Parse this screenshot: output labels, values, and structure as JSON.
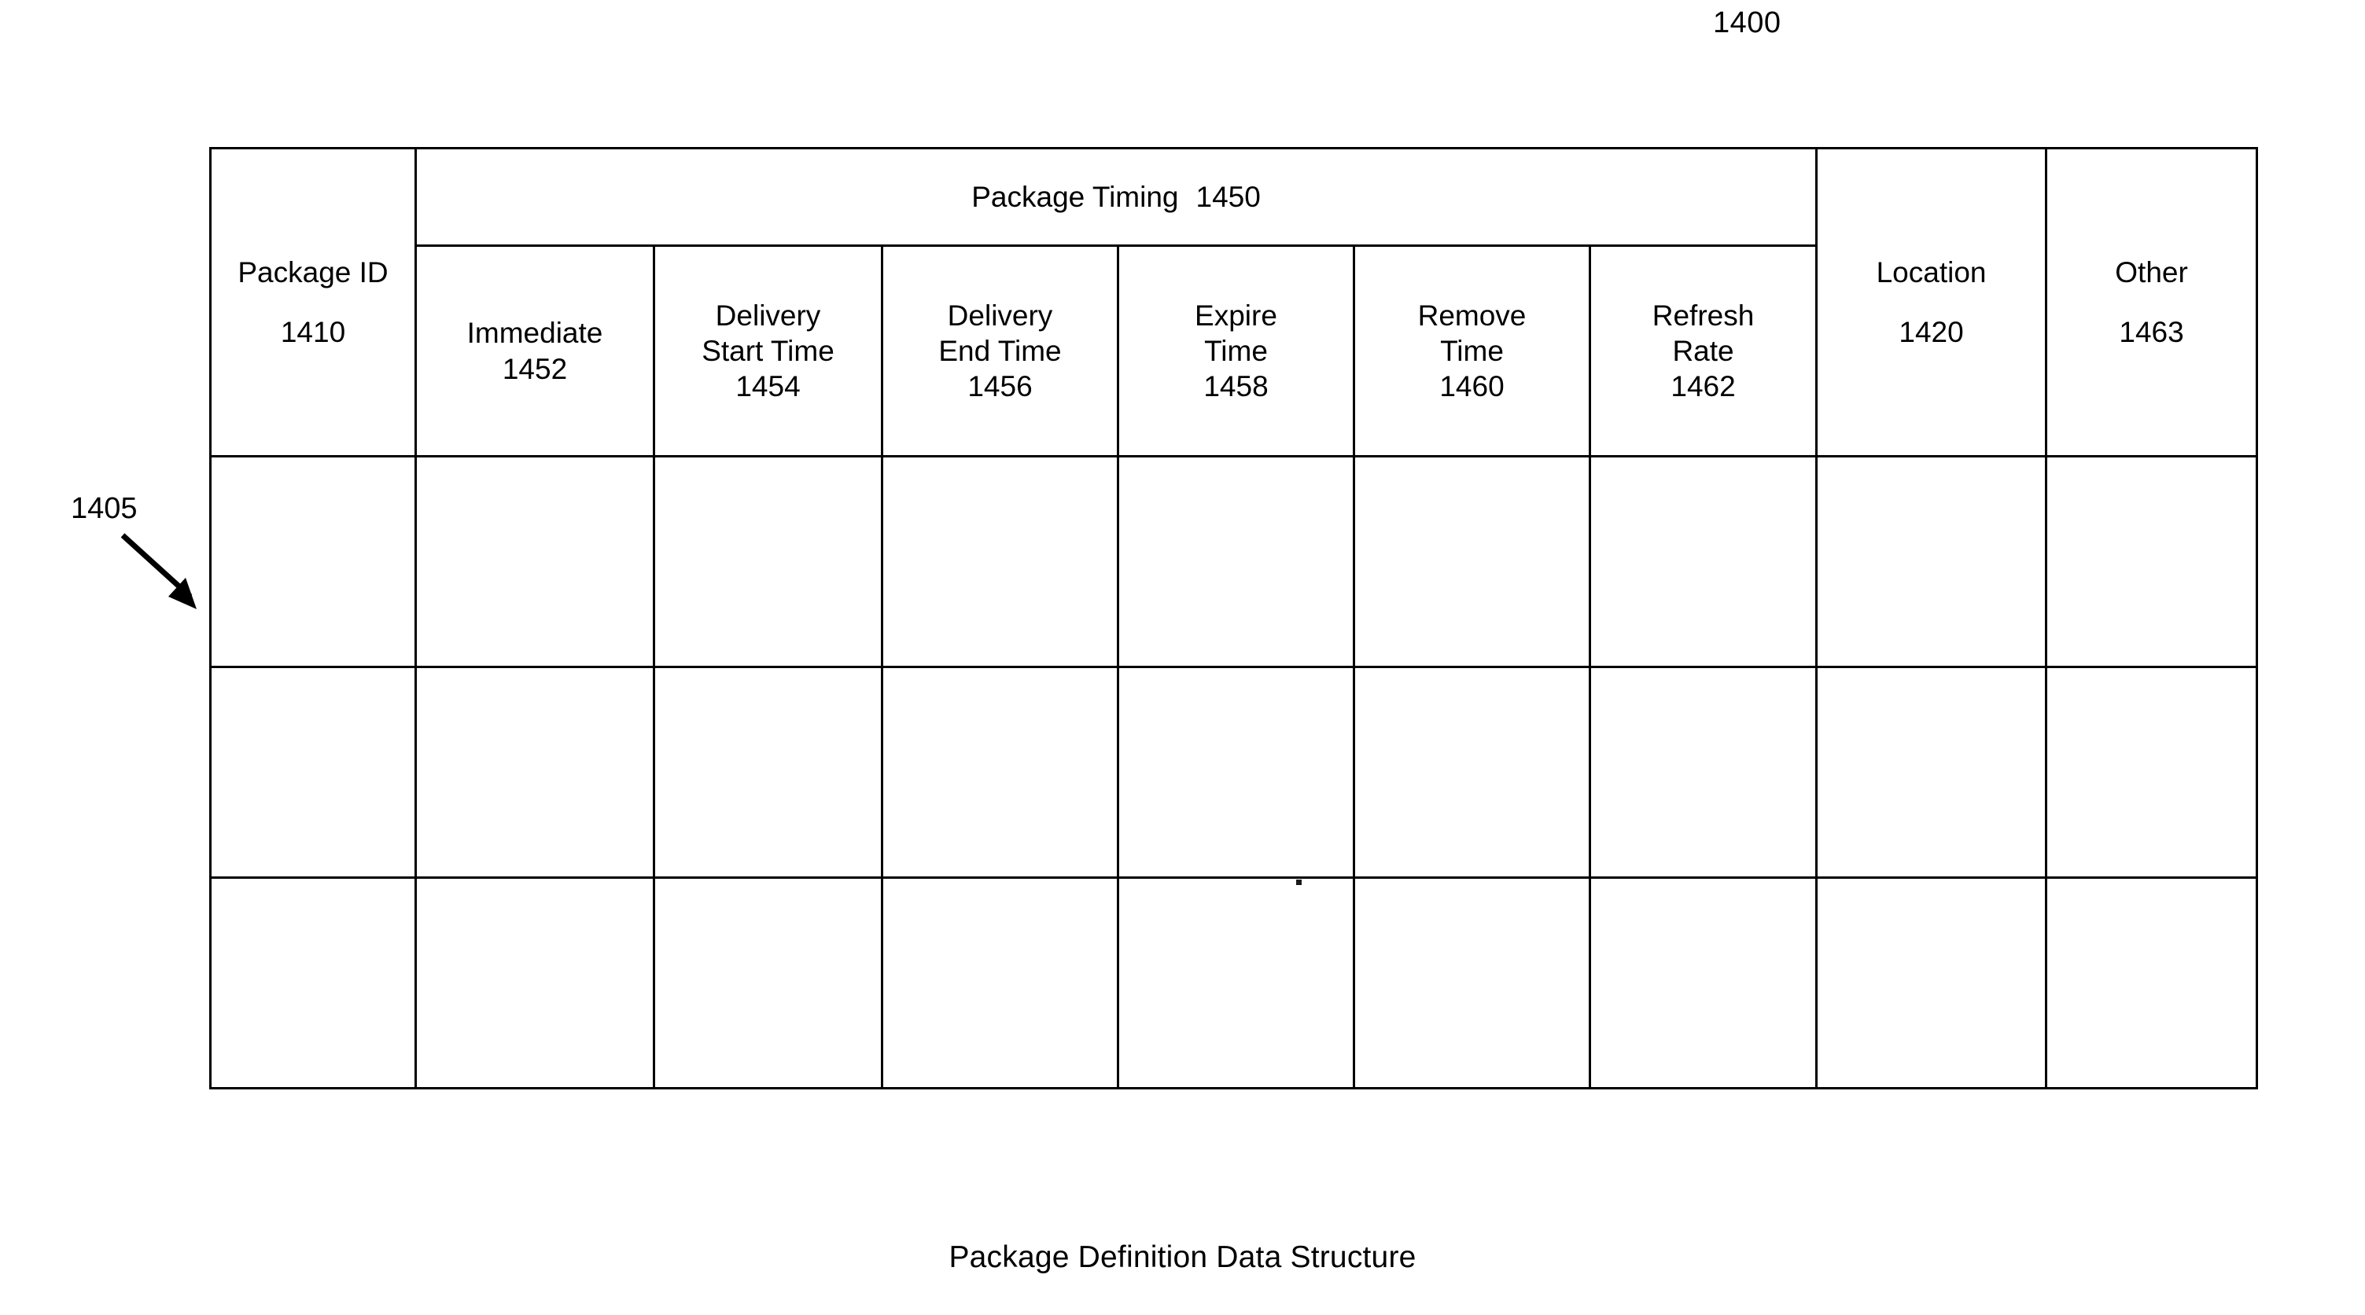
{
  "figure": {
    "number": "1400",
    "callout": "1405",
    "caption": "Package Definition Data Structure"
  },
  "table": {
    "group_header": {
      "label": "Package Timing",
      "ref": "1450"
    },
    "columns": [
      {
        "id": "package-id",
        "label": "Package\nID",
        "ref": "1410",
        "group": null
      },
      {
        "id": "immediate",
        "label": "Immediate",
        "ref": "1452",
        "group": "Package Timing"
      },
      {
        "id": "delivery-start-time",
        "label": "Delivery\nStart Time",
        "ref": "1454",
        "group": "Package Timing"
      },
      {
        "id": "delivery-end-time",
        "label": "Delivery\nEnd Time",
        "ref": "1456",
        "group": "Package Timing"
      },
      {
        "id": "expire-time",
        "label": "Expire\nTime",
        "ref": "1458",
        "group": "Package Timing"
      },
      {
        "id": "remove-time",
        "label": "Remove\nTime",
        "ref": "1460",
        "group": "Package Timing"
      },
      {
        "id": "refresh-rate",
        "label": "Refresh\nRate",
        "ref": "1462",
        "group": "Package Timing"
      },
      {
        "id": "location",
        "label": "Location",
        "ref": "1420",
        "group": null
      },
      {
        "id": "other",
        "label": "Other",
        "ref": "1463",
        "group": null
      }
    ],
    "rows": [
      {
        "cells": [
          "",
          "",
          "",
          "",
          "",
          "",
          "",
          "",
          ""
        ]
      },
      {
        "cells": [
          "",
          "",
          "",
          "",
          "",
          "",
          "",
          "",
          ""
        ]
      },
      {
        "cells": [
          "",
          "",
          "",
          "",
          "",
          "",
          "",
          "",
          ""
        ]
      }
    ]
  }
}
